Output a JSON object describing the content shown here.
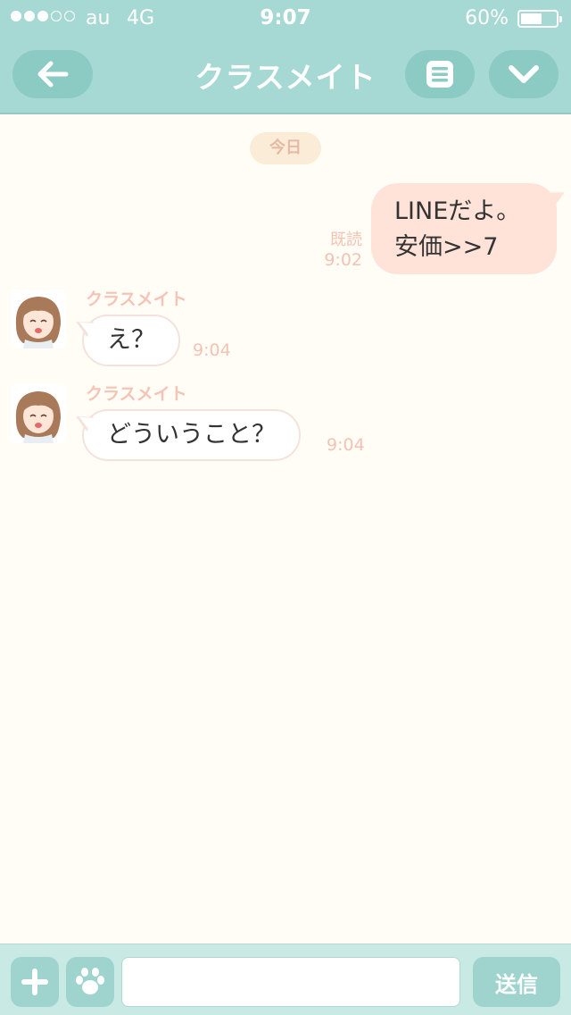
{
  "status_bar": {
    "carrier": "au",
    "network": "4G",
    "time": "9:07",
    "battery_percent_label": "60%",
    "battery_level": 0.6,
    "signal_bars_filled": 3,
    "signal_bars_total": 5
  },
  "nav": {
    "title": "クラスメイト",
    "back_icon": "arrow-left-icon",
    "menu_icon": "list-icon",
    "more_icon": "chevron-down-icon"
  },
  "chat": {
    "date_label": "今日",
    "outgoing": {
      "line1": "LINEだよ。",
      "line2": "安価>>7",
      "read_label": "既読",
      "time": "9:02"
    },
    "incoming": [
      {
        "sender": "クラスメイト",
        "text": "え？",
        "time": "9:04"
      },
      {
        "sender": "クラスメイト",
        "text": "どういうこと？",
        "time": "9:04"
      }
    ]
  },
  "composer": {
    "input_value": "",
    "input_placeholder": "",
    "send_label": "送信",
    "plus_icon": "plus-icon",
    "sticker_icon": "paw-icon"
  },
  "colors": {
    "header_bg": "#a7d9d4",
    "nav_button_bg": "#8ccbc4",
    "chat_bg": "#fffdf5",
    "outgoing_bubble": "#ffe3d9",
    "meta_text": "#f2c3b4",
    "composer_bg": "#c9e9e5"
  }
}
